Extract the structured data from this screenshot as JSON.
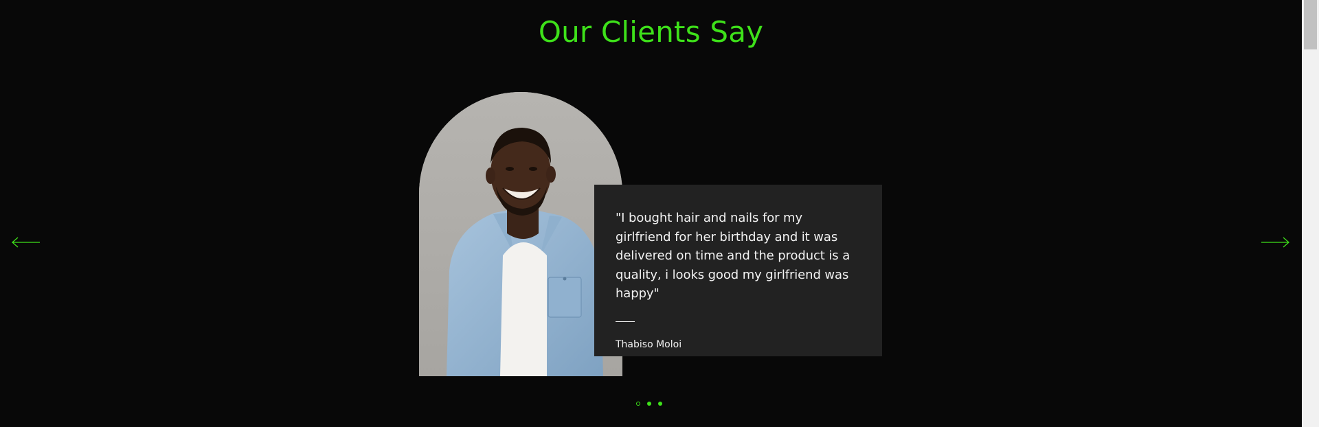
{
  "section": {
    "title": "Our Clients Say"
  },
  "testimonial": {
    "quote": "\"I bought hair and nails for my girlfriend for her birthday and it was delivered on time and the product is a quality, i looks good my girlfriend was happy\"",
    "author": "Thabiso Moloi"
  },
  "navigation": {
    "prev_icon": "arrow-left-icon",
    "next_icon": "arrow-right-icon",
    "dots": [
      {
        "state": "active"
      },
      {
        "state": "idle"
      },
      {
        "state": "idle"
      }
    ]
  },
  "colors": {
    "background": "#080808",
    "accent": "#3ee11a",
    "card": "#222222",
    "text": "#f2f2f2"
  }
}
